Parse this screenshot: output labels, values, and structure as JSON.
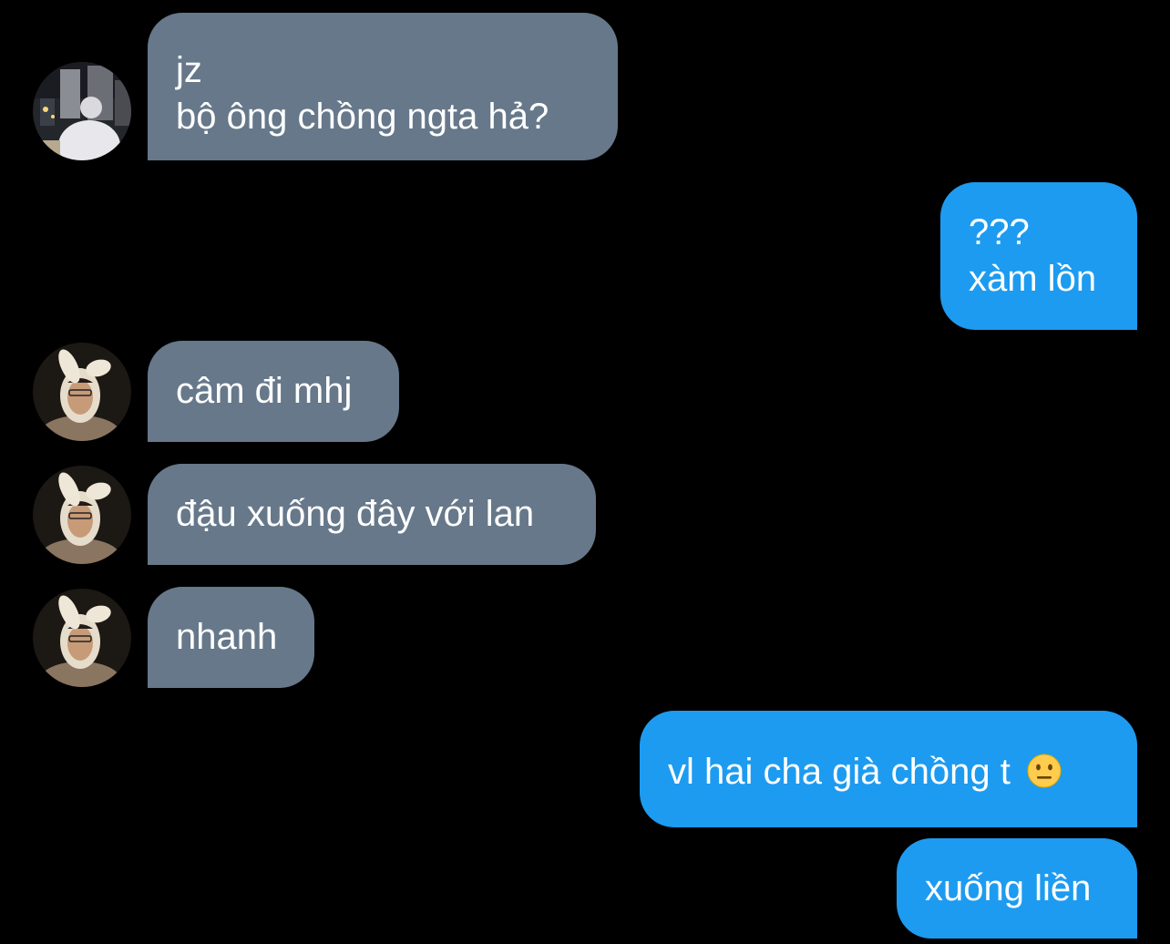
{
  "conversation": {
    "messages": [
      {
        "sender": "them",
        "lines": [
          "jz",
          "bộ ông chồng ngta hả?"
        ]
      },
      {
        "sender": "me",
        "lines": [
          "???",
          "xàm lồn"
        ]
      },
      {
        "sender": "them",
        "lines": [
          "câm đi mhj"
        ]
      },
      {
        "sender": "them",
        "lines": [
          "đậu xuống đây với lan"
        ]
      },
      {
        "sender": "them",
        "lines": [
          "nhanh"
        ]
      },
      {
        "sender": "me",
        "text": "vl hai cha già chồng t",
        "emoji": "neutral-face-emoji"
      },
      {
        "sender": "me",
        "lines": [
          "xuống liền"
        ]
      }
    ]
  },
  "colors": {
    "background": "#000000",
    "incoming_bubble": "#66788a",
    "outgoing_bubble": "#1d9bf0",
    "text": "#ffffff"
  },
  "avatars": {
    "first": "user-avatar-night-street-photo",
    "others": "user-avatar-bunny-hat-photo"
  }
}
